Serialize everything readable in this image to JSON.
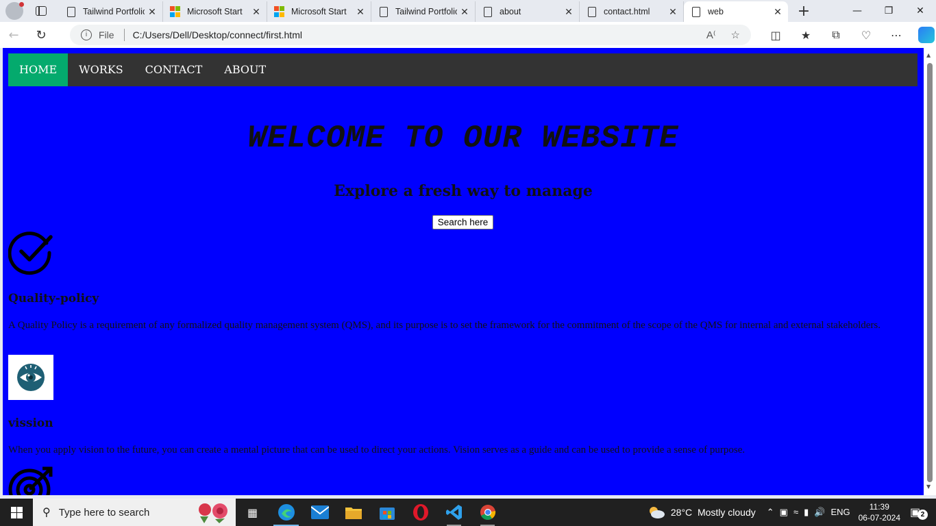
{
  "browser": {
    "tabs": [
      {
        "label": "Tailwind Portfolio",
        "icon": "page-icon"
      },
      {
        "label": "Microsoft Start",
        "icon": "microsoft-icon"
      },
      {
        "label": "Microsoft Start",
        "icon": "microsoft-icon"
      },
      {
        "label": "Tailwind Portfolio",
        "icon": "page-icon"
      },
      {
        "label": "about",
        "icon": "page-icon"
      },
      {
        "label": "contact.html",
        "icon": "page-icon"
      },
      {
        "label": "web",
        "icon": "page-icon",
        "active": true
      }
    ],
    "address": {
      "scheme_label": "File",
      "url": "C:/Users/Dell/Desktop/connect/first.html"
    }
  },
  "page": {
    "background": "#0000ff",
    "nav": {
      "items": [
        "HOME",
        "WORKS",
        "CONTACT",
        "ABOUT"
      ],
      "active_item": "HOME",
      "active_color": "#04aa6d",
      "bar_color": "#333333"
    },
    "hero": {
      "title": "WELCOME TO OUR WEBSITE",
      "subtitle": "Explore a fresh way to manage",
      "button": "Search here"
    },
    "features": [
      {
        "icon": "check-circle-icon",
        "title": "Quality-policy",
        "text": "A Quality Policy is a requirement of any formalized quality management system (QMS), and its purpose is to set the framework for the commitment of the scope of the QMS for internal and external stakeholders."
      },
      {
        "icon": "eye-icon",
        "title": "vission",
        "text": "When you apply vision to the future, you can create a mental picture that can be used to direct your actions. Vision serves as a guide and can be used to provide a sense of purpose."
      },
      {
        "icon": "target-icon"
      }
    ]
  },
  "taskbar": {
    "search_placeholder": "Type here to search",
    "weather": {
      "temperature": "28°C",
      "condition": "Mostly cloudy"
    },
    "language": "ENG",
    "time": "11:39",
    "date": "06-07-2024",
    "notification_count": "2"
  }
}
